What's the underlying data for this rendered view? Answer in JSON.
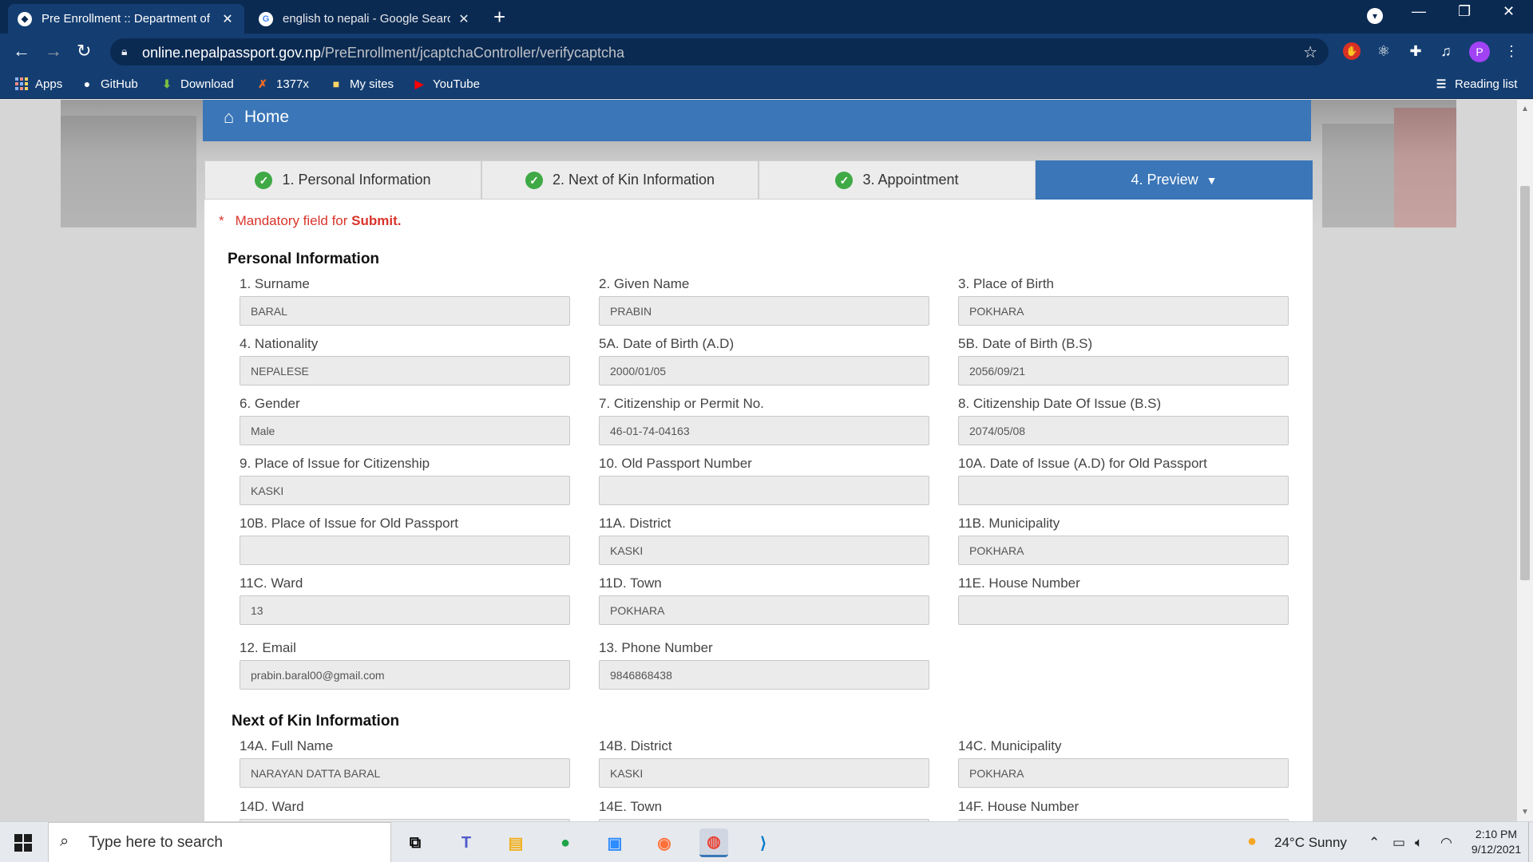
{
  "browser": {
    "tabs": [
      {
        "title": "Pre Enrollment :: Department of Passports",
        "active": true
      },
      {
        "title": "english to nepali - Google Search",
        "active": false
      }
    ],
    "new_tab": "+",
    "url_host": "online.nepalpassport.gov.np",
    "url_path": "/PreEnrollment/jcaptchaController/verifycaptcha",
    "bookmarks": [
      {
        "label": "Apps",
        "icon": "apps-grid-icon"
      },
      {
        "label": "GitHub",
        "icon": "github-icon"
      },
      {
        "label": "Download",
        "icon": "download-icon"
      },
      {
        "label": "1377x",
        "icon": "x-icon"
      },
      {
        "label": "My sites",
        "icon": "folder-icon"
      },
      {
        "label": "YouTube",
        "icon": "youtube-icon"
      }
    ],
    "reading_list": "Reading list",
    "profile_initial": "P"
  },
  "page": {
    "home": "Home",
    "steps": [
      {
        "label": "1. Personal Information",
        "done": true
      },
      {
        "label": "2. Next of Kin Information",
        "done": true
      },
      {
        "label": "3. Appointment",
        "done": true
      },
      {
        "label": "4. Preview",
        "active": true
      }
    ],
    "mandatory": {
      "star": "*",
      "text": "Mandatory field for ",
      "strong": "Submit."
    },
    "personal_title": "Personal Information",
    "personal_fields": [
      {
        "label": "1. Surname",
        "value": "BARAL"
      },
      {
        "label": "2. Given Name",
        "value": "PRABIN"
      },
      {
        "label": "3. Place of Birth",
        "value": "POKHARA"
      },
      {
        "label": "4. Nationality",
        "value": "NEPALESE"
      },
      {
        "label": "5A. Date of Birth (A.D)",
        "value": "2000/01/05"
      },
      {
        "label": "5B. Date of Birth (B.S)",
        "value": "2056/09/21"
      },
      {
        "label": "6. Gender",
        "value": "Male"
      },
      {
        "label": "7. Citizenship or Permit No.",
        "value": "46-01-74-04163"
      },
      {
        "label": "8. Citizenship Date Of Issue (B.S)",
        "value": "2074/05/08"
      },
      {
        "label": "9. Place of Issue for Citizenship",
        "value": "KASKI"
      },
      {
        "label": "10. Old Passport Number",
        "value": ""
      },
      {
        "label": "10A. Date of Issue (A.D) for Old Passport",
        "value": ""
      },
      {
        "label": "10B. Place of Issue for Old Passport",
        "value": ""
      },
      {
        "label": "11A. District",
        "value": "KASKI"
      },
      {
        "label": "11B. Municipality",
        "value": "POKHARA"
      },
      {
        "label": "11C. Ward",
        "value": "13"
      },
      {
        "label": "11D. Town",
        "value": "POKHARA"
      },
      {
        "label": "11E. House Number",
        "value": ""
      },
      {
        "label": "12. Email",
        "value": "prabin.baral00@gmail.com"
      },
      {
        "label": "13. Phone Number",
        "value": "9846868438"
      }
    ],
    "kin_title": "Next of Kin Information",
    "kin_fields": [
      {
        "label": "14A. Full Name",
        "value": "NARAYAN DATTA BARAL"
      },
      {
        "label": "14B. District",
        "value": "KASKI"
      },
      {
        "label": "14C. Municipality",
        "value": "POKHARA"
      },
      {
        "label": "14D. Ward",
        "value": ""
      },
      {
        "label": "14E. Town",
        "value": ""
      },
      {
        "label": "14F. House Number",
        "value": ""
      }
    ]
  },
  "taskbar": {
    "search_placeholder": "Type here to search",
    "weather": "24°C  Sunny",
    "time": "2:10 PM",
    "date": "9/12/2021"
  }
}
